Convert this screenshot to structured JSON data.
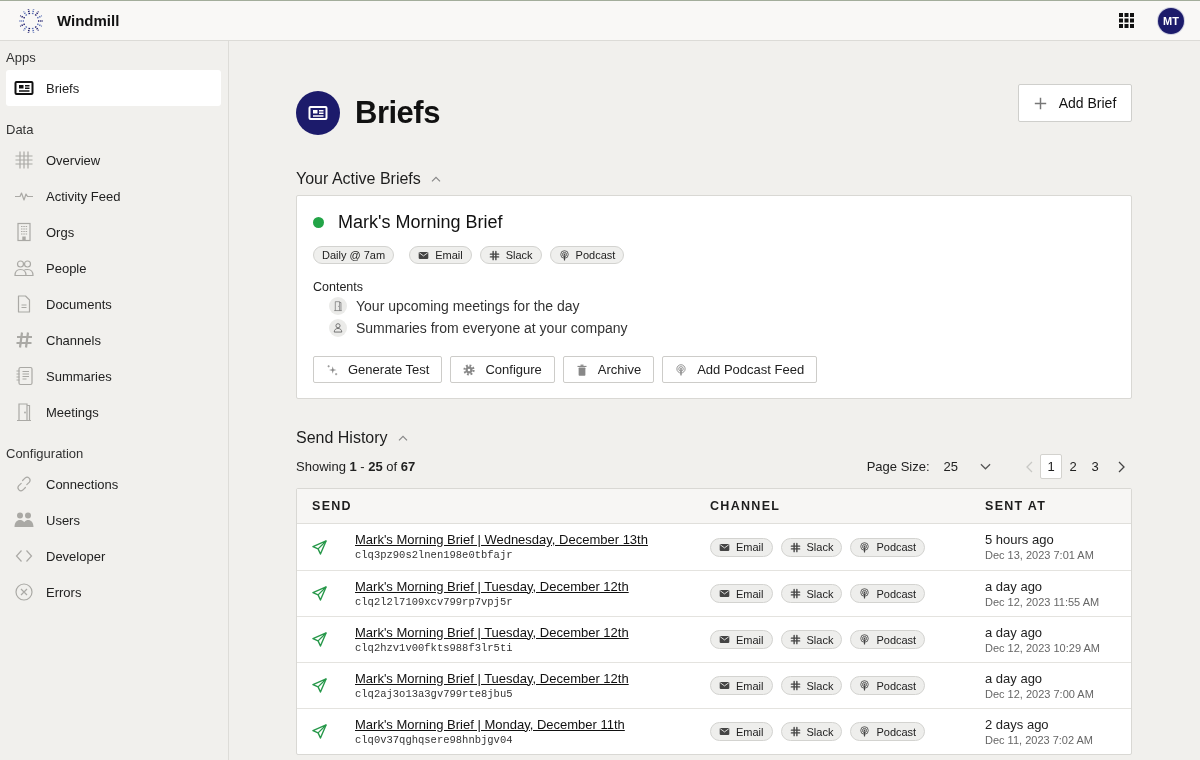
{
  "app": {
    "name": "Windmill",
    "avatar": "MT"
  },
  "sidebar": {
    "sections": [
      {
        "title": "Apps",
        "items": [
          {
            "label": "Briefs",
            "selected": true
          }
        ]
      },
      {
        "title": "Data",
        "items": [
          {
            "label": "Overview",
            "selected": false
          },
          {
            "label": "Activity Feed",
            "selected": false
          },
          {
            "label": "Orgs",
            "selected": false
          },
          {
            "label": "People",
            "selected": false
          },
          {
            "label": "Documents",
            "selected": false
          },
          {
            "label": "Channels",
            "selected": false
          },
          {
            "label": "Summaries",
            "selected": false
          },
          {
            "label": "Meetings",
            "selected": false
          }
        ]
      },
      {
        "title": "Configuration",
        "items": [
          {
            "label": "Connections",
            "selected": false
          },
          {
            "label": "Users",
            "selected": false
          },
          {
            "label": "Developer",
            "selected": false
          },
          {
            "label": "Errors",
            "selected": false
          }
        ]
      }
    ]
  },
  "page": {
    "title": "Briefs",
    "add_button": "Add Brief"
  },
  "active_briefs": {
    "heading": "Your Active Briefs",
    "expanded": true,
    "briefs": [
      {
        "name": "Mark's Morning Brief",
        "color": "#22a447",
        "schedule": "Daily @ 7am",
        "channels": [
          {
            "kind": "email",
            "label": "Email"
          },
          {
            "kind": "slack",
            "label": "Slack"
          },
          {
            "kind": "podcast",
            "label": "Podcast"
          }
        ],
        "contents_label": "Contents",
        "contents": [
          "Your upcoming meetings for the day",
          "Summaries from everyone at your company"
        ],
        "actions": [
          "Generate Test",
          "Configure",
          "Archive",
          "Add Podcast Feed"
        ]
      }
    ]
  },
  "send_history": {
    "heading": "Send History",
    "expanded": true,
    "showing": "Showing **1** - **25** of **67**",
    "page_size": {
      "label": "Page Size:",
      "value": "25"
    },
    "pagination": {
      "previous": {
        "disabled": true
      },
      "pages": [
        {
          "label": "1",
          "selected": true
        },
        {
          "label": "2",
          "selected": false
        },
        {
          "label": "3",
          "selected": false
        }
      ],
      "next": {
        "disabled": false
      }
    },
    "table": {
      "columns": [
        "SEND",
        "CHANNEL",
        "SENT AT"
      ],
      "rows": [
        {
          "title": "Mark's Morning Brief | Wednesday, December 13th",
          "id": "clq3pz90s2lnen198e0tbfajr",
          "channels": [
            {
              "kind": "email",
              "label": "Email"
            },
            {
              "kind": "slack",
              "label": "Slack"
            },
            {
              "kind": "podcast",
              "label": "Podcast"
            }
          ],
          "sent_relative": "5 hours ago",
          "sent_at": "Dec 13, 2023 7:01 AM"
        },
        {
          "title": "Mark's Morning Brief | Tuesday, December 12th",
          "id": "clq2l2l7109xcv799rp7vpj5r",
          "channels": [
            {
              "kind": "email",
              "label": "Email"
            },
            {
              "kind": "slack",
              "label": "Slack"
            },
            {
              "kind": "podcast",
              "label": "Podcast"
            }
          ],
          "sent_relative": "a day ago",
          "sent_at": "Dec 12, 2023 11:55 AM"
        },
        {
          "title": "Mark's Morning Brief | Tuesday, December 12th",
          "id": "clq2hzv1v00fkts988f3lr5ti",
          "channels": [
            {
              "kind": "email",
              "label": "Email"
            },
            {
              "kind": "slack",
              "label": "Slack"
            },
            {
              "kind": "podcast",
              "label": "Podcast"
            }
          ],
          "sent_relative": "a day ago",
          "sent_at": "Dec 12, 2023 10:29 AM"
        },
        {
          "title": "Mark's Morning Brief | Tuesday, December 12th",
          "id": "clq2aj3o13a3gv799rte8jbu5",
          "channels": [
            {
              "kind": "email",
              "label": "Email"
            },
            {
              "kind": "slack",
              "label": "Slack"
            },
            {
              "kind": "podcast",
              "label": "Podcast"
            }
          ],
          "sent_relative": "a day ago",
          "sent_at": "Dec 12, 2023 7:00 AM"
        },
        {
          "title": "Mark's Morning Brief | Monday, December 11th",
          "id": "clq0v37qghqsere98hnbjgv04",
          "channels": [
            {
              "kind": "email",
              "label": "Email"
            },
            {
              "kind": "slack",
              "label": "Slack"
            },
            {
              "kind": "podcast",
              "label": "Podcast"
            }
          ],
          "sent_relative": "2 days ago",
          "sent_at": "Dec 11, 2023 7:02 AM"
        }
      ]
    }
  }
}
